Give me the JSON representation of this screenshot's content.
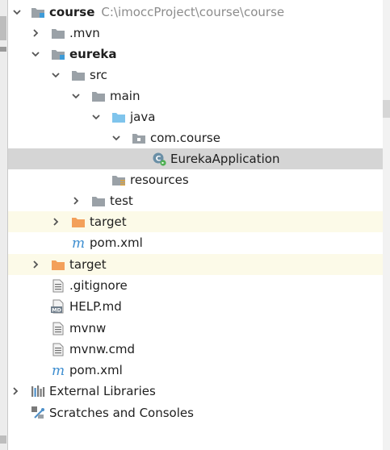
{
  "colors": {
    "selection": "#d5d5d5",
    "excluded_highlight": "#fcfae8",
    "folder_gray": "#9aa1a7",
    "folder_orange": "#f3a05a",
    "source_folder_blue": "#7fc4ec",
    "module_marker_blue": "#3e9bd8"
  },
  "tree": {
    "root": {
      "label": "course",
      "path": "C:\\imoccProject\\course\\course",
      "icon": "module-folder-icon",
      "expanded": true
    },
    "mvn": {
      "label": ".mvn",
      "icon": "folder-icon",
      "expanded": false
    },
    "eureka": {
      "label": "eureka",
      "icon": "module-folder-icon",
      "expanded": true
    },
    "src": {
      "label": "src",
      "icon": "folder-icon",
      "expanded": true
    },
    "main": {
      "label": "main",
      "icon": "folder-icon",
      "expanded": true
    },
    "java": {
      "label": "java",
      "icon": "source-root-folder-icon",
      "expanded": true
    },
    "com_course": {
      "label": "com.course",
      "icon": "package-icon",
      "expanded": true
    },
    "eureka_application": {
      "label": "EurekaApplication",
      "icon": "spring-boot-class-icon",
      "selected": true
    },
    "resources": {
      "label": "resources",
      "icon": "resources-folder-icon"
    },
    "test": {
      "label": "test",
      "icon": "folder-icon",
      "expanded": false
    },
    "eureka_target": {
      "label": "target",
      "icon": "excluded-folder-icon",
      "expanded": false
    },
    "eureka_pom": {
      "label": "pom.xml",
      "icon": "maven-icon"
    },
    "root_target": {
      "label": "target",
      "icon": "excluded-folder-icon",
      "expanded": false
    },
    "gitignore": {
      "label": ".gitignore",
      "icon": "text-file-icon"
    },
    "help_md": {
      "label": "HELP.md",
      "icon": "markdown-file-icon",
      "icon_text": "MD"
    },
    "mvnw": {
      "label": "mvnw",
      "icon": "text-file-icon"
    },
    "mvnw_cmd": {
      "label": "mvnw.cmd",
      "icon": "text-file-icon"
    },
    "root_pom": {
      "label": "pom.xml",
      "icon": "maven-icon"
    },
    "external_libraries": {
      "label": "External Libraries",
      "icon": "libraries-icon",
      "expanded": false
    },
    "scratches": {
      "label": "Scratches and Consoles",
      "icon": "scratches-icon"
    }
  }
}
